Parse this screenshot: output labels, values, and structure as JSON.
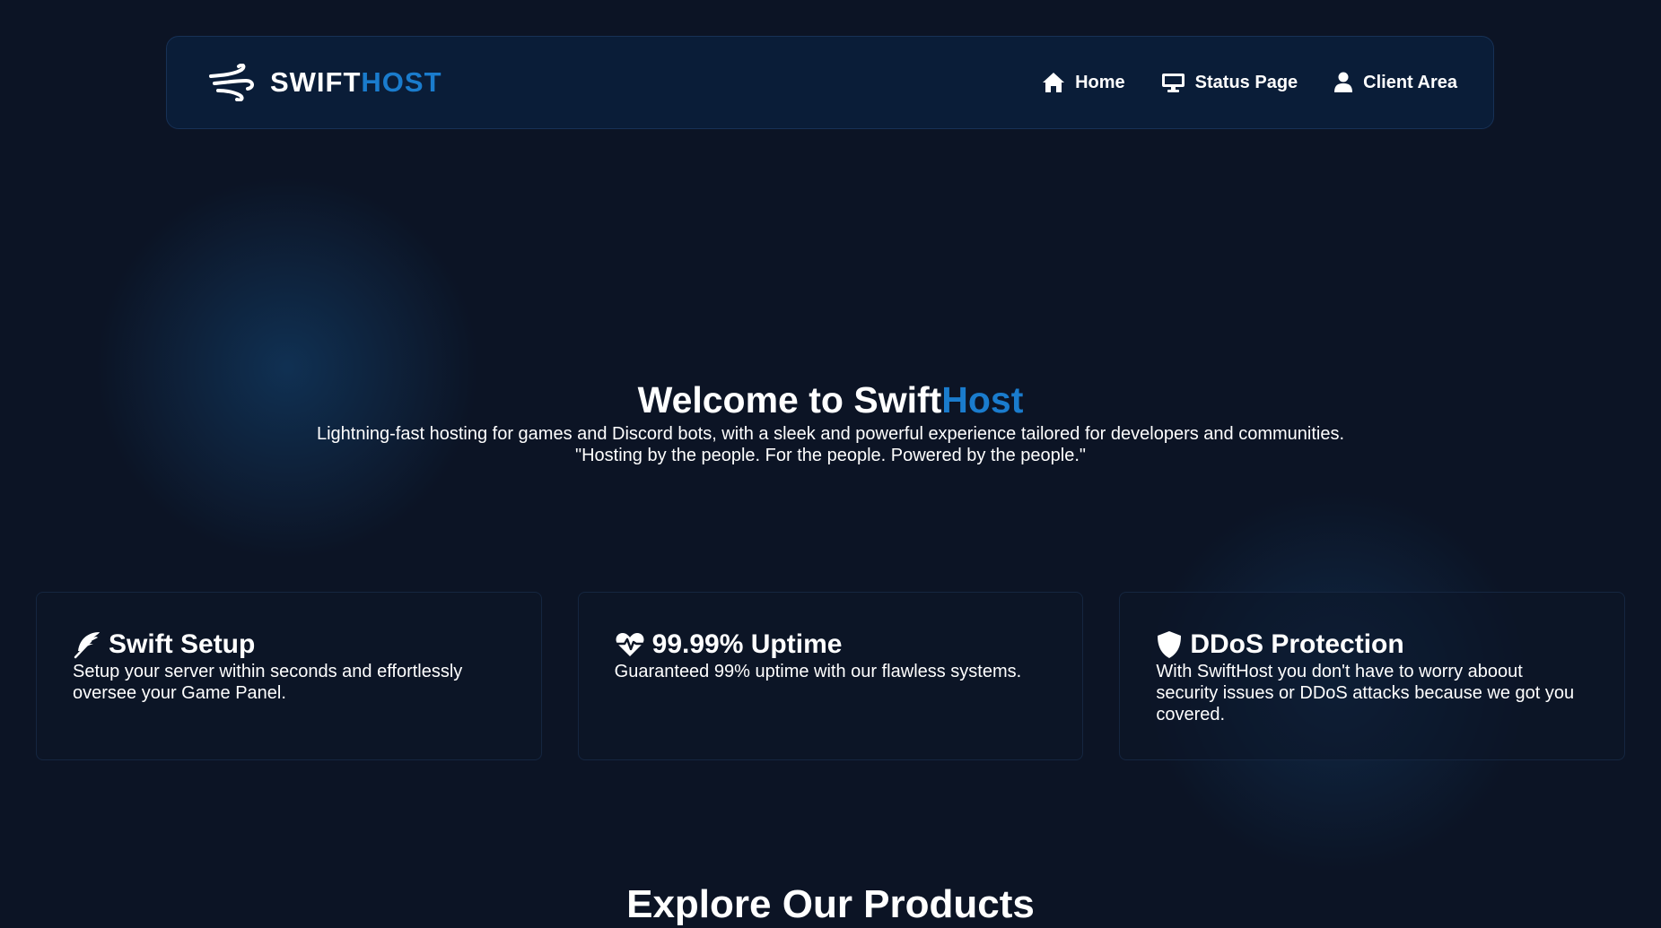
{
  "brand": {
    "name_part1": "SWIFT",
    "name_part2": "HOST",
    "logo_icon": "wind-icon"
  },
  "nav": {
    "items": [
      {
        "label": "Home",
        "icon": "home-icon"
      },
      {
        "label": "Status Page",
        "icon": "monitor-icon"
      },
      {
        "label": "Client Area",
        "icon": "user-icon"
      }
    ]
  },
  "hero": {
    "title_part1": "Welcome to Swift",
    "title_part2": "Host",
    "subtitle": "Lightning-fast hosting for games and Discord bots, with a sleek and powerful experience tailored for developers and communities.",
    "quote": "\"Hosting by the people. For the people. Powered by the people.\""
  },
  "features": [
    {
      "title": "Swift Setup",
      "icon": "feather-icon",
      "description": "Setup your server within seconds and effortlessly oversee your Game Panel."
    },
    {
      "title": "99.99% Uptime",
      "icon": "heart-pulse-icon",
      "description": "Guaranteed 99% uptime with our flawless systems."
    },
    {
      "title": "DDoS Protection",
      "icon": "shield-icon",
      "description": "With SwiftHost you don't have to worry aboout security issues or DDoS attacks because we got you covered."
    }
  ],
  "products": {
    "title": "Explore Our Products"
  },
  "colors": {
    "background": "#0c1425",
    "navbar": "#0a1d38",
    "accent": "#1a7ccd",
    "text": "#ffffff"
  }
}
